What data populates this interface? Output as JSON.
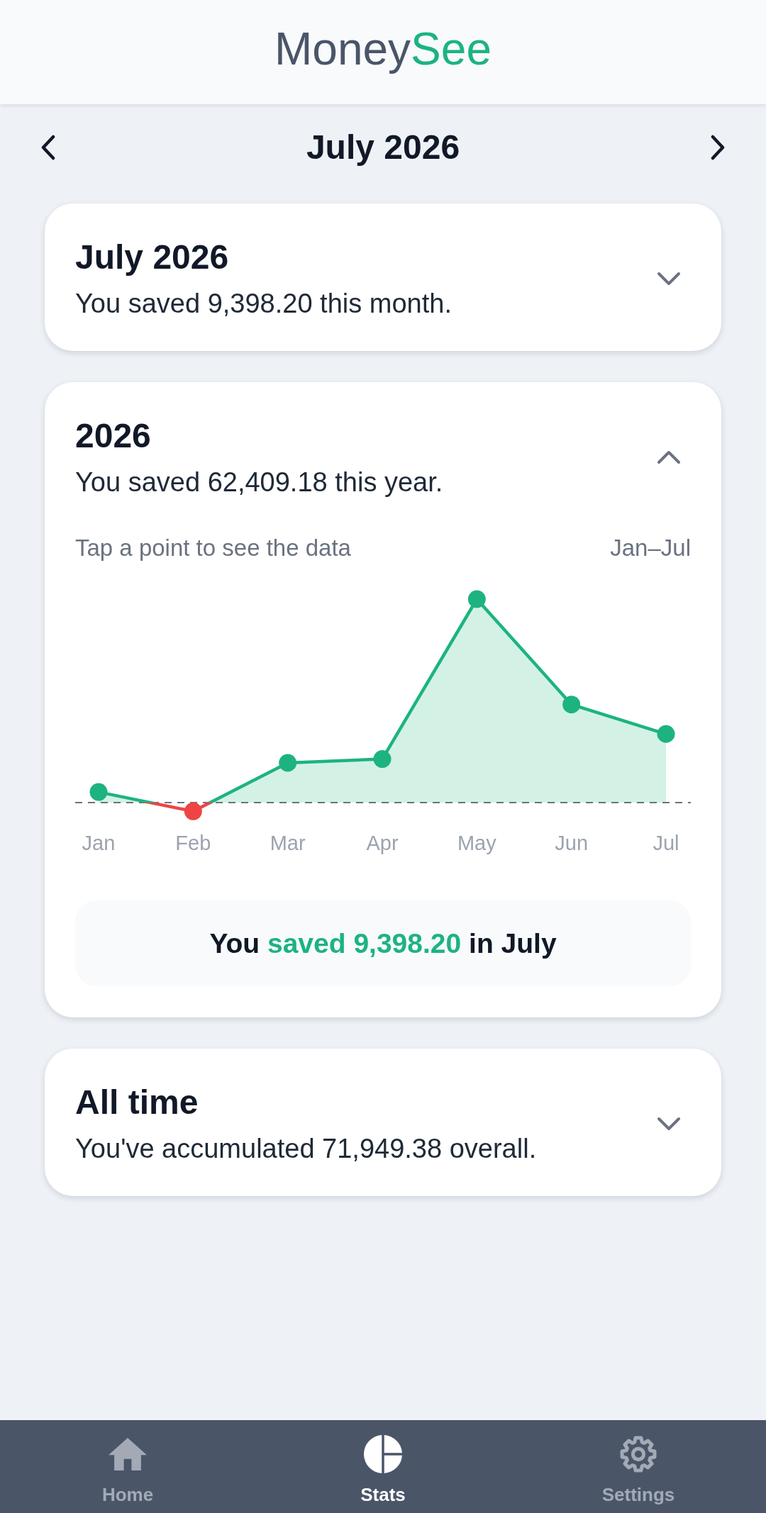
{
  "header": {
    "logo": {
      "text": "Money",
      "accent": "See"
    }
  },
  "month_nav": {
    "title": "July 2026"
  },
  "cards": [
    {
      "title": "July 2026",
      "subtitle": "You saved 9,398.20 this month.",
      "expanded": false
    },
    {
      "title": "2026",
      "subtitle": "You saved 62,409.18 this year.",
      "expanded": true,
      "chart": {
        "hint": "Tap a point to see the data",
        "range": "Jan–Jul",
        "months": [
          "Jan",
          "Feb",
          "Mar",
          "Apr",
          "May",
          "Jun",
          "Jul"
        ]
      },
      "selection_summary": {
        "prefix": "You",
        "highlight": "saved 9,398.20",
        "suffix": "in July"
      }
    },
    {
      "title": "All time",
      "subtitle": "You've accumulated 71,949.38 overall.",
      "expanded": false
    }
  ],
  "tab_bar": [
    {
      "label": "Home",
      "selected": false
    },
    {
      "label": "Stats",
      "selected": true
    },
    {
      "label": "Settings",
      "selected": false
    }
  ]
}
